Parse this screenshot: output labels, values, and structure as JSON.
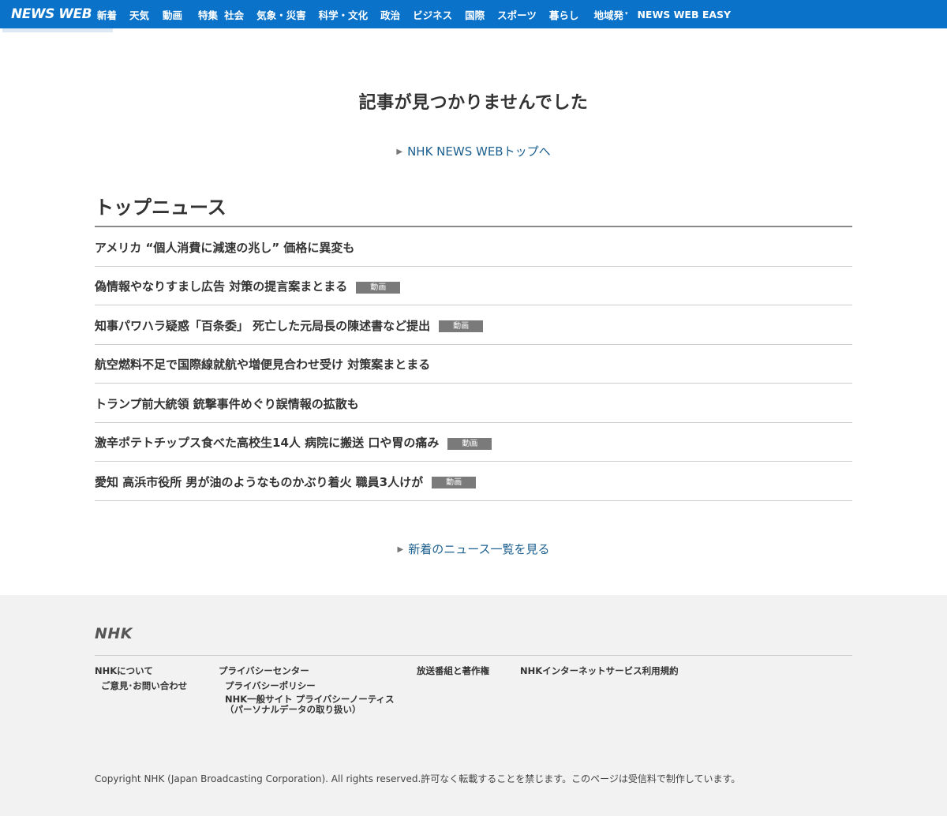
{
  "header": {
    "logo": "NEWS WEB",
    "nav": [
      {
        "label": "新着"
      },
      {
        "label": "天気"
      },
      {
        "label": "動画"
      },
      {
        "label": "特集"
      },
      {
        "label": "社会"
      },
      {
        "label": "気象・災害"
      },
      {
        "label": "科学・文化"
      },
      {
        "label": "政治"
      },
      {
        "label": "ビジネス"
      },
      {
        "label": "国際"
      },
      {
        "label": "スポーツ"
      },
      {
        "label": "暮らし"
      },
      {
        "label": "地域発"
      },
      {
        "label": "NEWS WEB EASY"
      }
    ],
    "dropdown_caret": "▾"
  },
  "main": {
    "not_found": "記事が見つかりませんでした",
    "top_link": "NHK NEWS WEBトップへ",
    "section_title": "トップニュース",
    "video_badge": "動画",
    "news": [
      {
        "title": "アメリカ “個人消費に減速の兆し” 価格に異変も",
        "video": false
      },
      {
        "title": "偽情報やなりすまし広告 対策の提言案まとまる",
        "video": true
      },
      {
        "title": "知事パワハラ疑惑「百条委」 死亡した元局長の陳述書など提出",
        "video": true
      },
      {
        "title": "航空燃料不足で国際線就航や増便見合わせ受け 対策案まとまる",
        "video": false
      },
      {
        "title": "トランプ前大統領 銃撃事件めぐり誤情報の拡散も",
        "video": false
      },
      {
        "title": "激辛ポテトチップス食べた高校生14人 病院に搬送 口や胃の痛み",
        "video": true
      },
      {
        "title": "愛知 高浜市役所 男が油のようなものかぶり着火 職員3人けが",
        "video": true
      }
    ],
    "more_link": "新着のニュース一覧を見る"
  },
  "footer": {
    "logo": "NHK",
    "about": "NHKについて",
    "feedback": "ご意見･お問い合わせ",
    "privacy_center": "プライバシーセンター",
    "privacy_policy": "プライバシーポリシー",
    "privacy_notice_1": "NHK一般サイト プライバシーノーティス",
    "privacy_notice_2": "（パーソナルデータの取り扱い）",
    "copyright_works": "放送番組と著作権",
    "terms": "NHKインターネットサービス利用規約",
    "copyright": "Copyright NHK (Japan Broadcasting Corporation). All rights reserved.許可なく転載することを禁じます。このページは受信料で制作しています。"
  },
  "colors": {
    "header_bg": "#0a73c9",
    "link": "#1b5f8f",
    "badge_bg": "#7a7a7a",
    "footer_bg": "#f2f2f2"
  }
}
